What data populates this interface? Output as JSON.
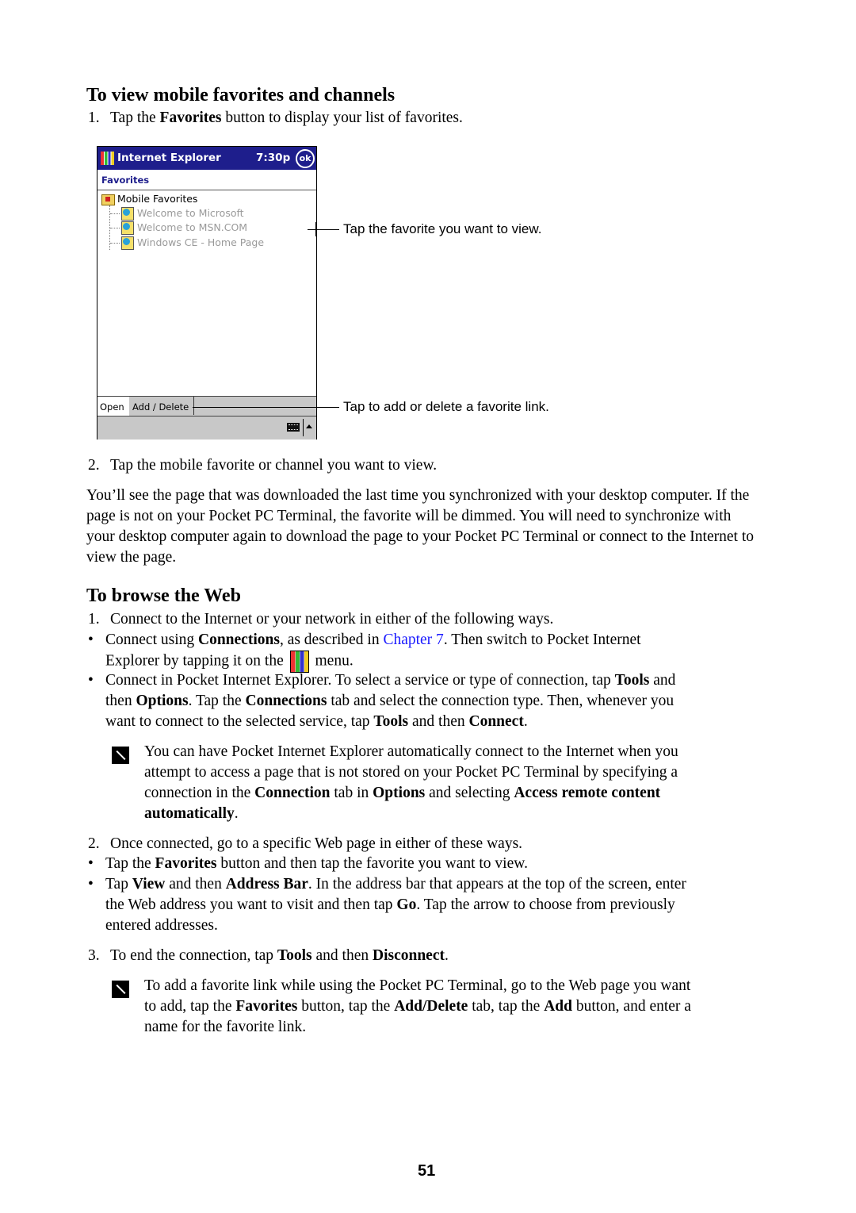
{
  "section1": {
    "heading": "To view mobile favorites and channels",
    "step1": {
      "num": "1.",
      "pre": "Tap the ",
      "b1": "Favorites",
      "post": " button to display your list of favorites."
    },
    "step2": {
      "num": "2.",
      "text": "Tap the mobile favorite or channel you want to view."
    },
    "para": "You’ll see the page that was downloaded the last time you synchronized with your desktop computer. If the page is not on your Pocket PC Terminal, the favorite will be dimmed. You will need to synchronize with your desktop computer again to download the page to your Pocket PC Terminal or connect to the Internet to view the page."
  },
  "device": {
    "app_title": "Internet Explorer",
    "time": "7:30p",
    "ok_label": "ok",
    "section_label": "Favorites",
    "folder": "Mobile Favorites",
    "items": [
      "Welcome to Microsoft",
      "Welcome to MSN.COM",
      "Windows CE - Home Page"
    ],
    "tabs": [
      "Open",
      "Add / Delete"
    ]
  },
  "callouts": {
    "tap_favorite": "Tap the favorite you want to view.",
    "add_delete": "Tap to add or delete a favorite link."
  },
  "section2": {
    "heading": "To browse the Web",
    "step1": "Connect to the Internet or your network in either of the following ways.",
    "b1": {
      "a": "Connect using ",
      "b": "Connections",
      "c": ", as described in ",
      "link": "Chapter 7",
      "d": ". Then switch to Pocket Internet",
      "e": "Explorer by tapping it on the ",
      "f": " menu."
    },
    "b2": {
      "a": "Connect in Pocket Internet Explorer. To select a service or type of connection, tap ",
      "b": "Tools",
      "c": " and",
      "d": "then ",
      "e": "Options",
      "f": ". Tap the ",
      "g": "Connections",
      "h": " tab and select the connection type. Then, whenever you",
      "i": "want to connect to the selected service, tap ",
      "j": "Tools",
      "k": " and then ",
      "l": "Connect",
      "m": "."
    },
    "note1": {
      "l1": "You can have Pocket Internet Explorer automatically connect to the Internet when you",
      "l2": "attempt to access a page that is not stored on your Pocket PC Terminal by specifying a",
      "l3a": "connection in the ",
      "l3b": "Connection",
      "l3c": " tab in ",
      "l3d": "Options",
      "l3e": " and selecting ",
      "l3f": "Access remote content",
      "l4a": "automatically",
      "l4b": "."
    },
    "step2": "Once connected, go to a specific Web page in either of these ways.",
    "b3": {
      "a": "Tap the ",
      "b": "Favorites",
      "c": " button and then tap the favorite you want to view."
    },
    "b4": {
      "a": "Tap ",
      "b": "View",
      "c": " and then ",
      "d": "Address Bar",
      "e": ". In the address bar that appears at the top of the screen, enter",
      "f": "the Web address you want to visit and then tap ",
      "g": "Go",
      "h": ". Tap the arrow to choose from previously",
      "i": "entered addresses."
    },
    "step3": {
      "a": "To end the connection, tap ",
      "b": "Tools",
      "c": " and then ",
      "d": "Disconnect",
      "e": "."
    },
    "note2": {
      "l1": "To add a favorite link while using the Pocket PC Terminal, go to the Web page you want",
      "l2a": "to add, tap the ",
      "l2b": "Favorites",
      "l2c": " button, tap the ",
      "l2d": "Add/Delete",
      "l2e": " tab, tap the ",
      "l2f": "Add",
      "l2g": " button, and enter a",
      "l3": "name for the favorite link."
    }
  },
  "page_number": "51"
}
